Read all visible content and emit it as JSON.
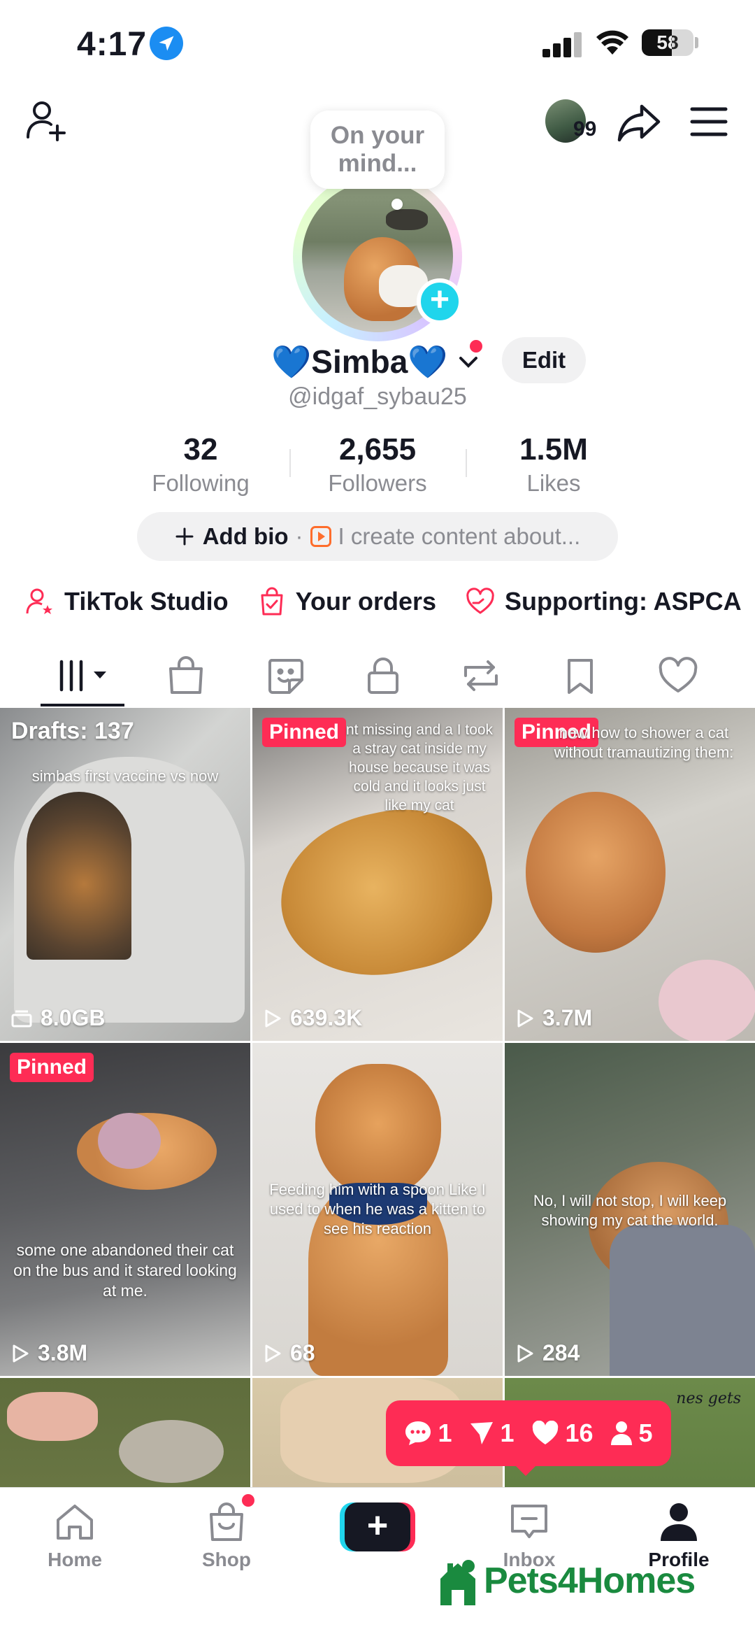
{
  "status_bar": {
    "time": "4:17",
    "battery": "58",
    "battery_level": 0.58
  },
  "header": {
    "friends_count": "99",
    "avatar_bubble": "On your mind...",
    "bubble_lines": [
      "On your",
      "mind..."
    ]
  },
  "profile": {
    "display_name": "💙Simba💙",
    "username": "@idgaf_sybau25",
    "edit_label": "Edit",
    "stats": [
      {
        "value": "32",
        "label": "Following"
      },
      {
        "value": "2,655",
        "label": "Followers"
      },
      {
        "value": "1.5M",
        "label": "Likes"
      }
    ],
    "bio": {
      "add_label": "Add bio",
      "separator": "·",
      "hint": "I create content about..."
    }
  },
  "links": [
    {
      "label": "TikTok Studio",
      "icon": "person-star-icon"
    },
    {
      "label": "Your orders",
      "icon": "bag-check-icon"
    },
    {
      "label": "Supporting: ASPCA",
      "icon": "heart-hands-icon"
    }
  ],
  "tabs": [
    "videos-grid-icon",
    "shop-bag-icon",
    "sticker-icon",
    "lock-icon",
    "repost-icon",
    "bookmark-icon",
    "heart-icon"
  ],
  "grid": [
    {
      "badge": "Drafts: 137",
      "caption": "simbas first vaccine vs now",
      "stat": "8.0GB",
      "stat_icon": "drafts-icon"
    },
    {
      "badge": "Pinned",
      "caption": "nt missing and a I took a stray cat inside my house because it was cold and it looks just like my cat",
      "stat": "639.3K",
      "stat_icon": "play-icon"
    },
    {
      "badge": "Pinned",
      "caption": "now how to shower a cat without tramautizing them:",
      "stat": "3.7M",
      "stat_icon": "play-icon"
    },
    {
      "badge": "Pinned",
      "caption": "some one abandoned their cat on the bus and it stared looking at me.",
      "stat": "3.8M",
      "stat_icon": "play-icon"
    },
    {
      "badge": "",
      "caption": "Feeding him with a spoon Like I used to when he was a kitten to see his reaction",
      "stat": "68",
      "stat_icon": "play-icon"
    },
    {
      "badge": "",
      "caption": "No, I will not stop, I will keep showing my cat the world.",
      "stat": "284",
      "stat_icon": "play-icon"
    },
    {
      "badge": "",
      "caption": "",
      "stat": "",
      "stat_icon": ""
    },
    {
      "badge": "",
      "caption": "",
      "stat": "",
      "stat_icon": ""
    },
    {
      "badge": "",
      "caption": "nes gets",
      "stat": "",
      "stat_icon": ""
    }
  ],
  "notifications": {
    "comments": "1",
    "mentions": "1",
    "likes": "16",
    "followers": "5"
  },
  "bottom_nav": [
    {
      "label": "Home",
      "icon": "home-icon"
    },
    {
      "label": "Shop",
      "icon": "shop-icon"
    },
    {
      "label": "",
      "icon": "create-icon"
    },
    {
      "label": "Inbox",
      "icon": "inbox-icon"
    },
    {
      "label": "Profile",
      "icon": "profile-icon"
    }
  ],
  "watermark": "Pets4Homes",
  "colors": {
    "accent": "#fe2c55",
    "cyan": "#20d5ec",
    "text": "#161823",
    "muted": "#8a8b91",
    "watermark": "#1a8a3f"
  }
}
